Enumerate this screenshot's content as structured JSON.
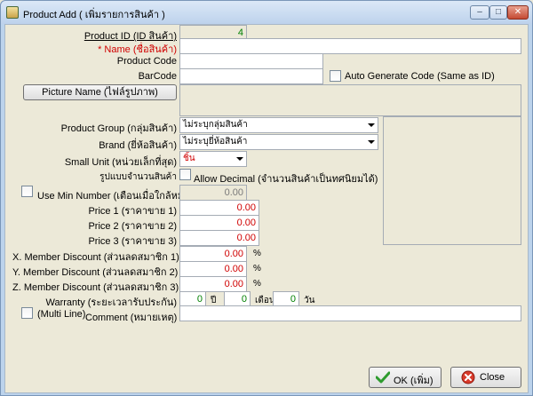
{
  "window": {
    "title": "Product Add ( เพิ่มรายการสินค้า )"
  },
  "titlebar": {
    "min": "–",
    "max": "□",
    "close": "✕"
  },
  "form": {
    "product_id": {
      "label": "Product ID (ID สินค้า)",
      "value": "4"
    },
    "name": {
      "label": "* Name (ชื่อสินค้า)",
      "value": ""
    },
    "product_code": {
      "label": "Product Code",
      "value": ""
    },
    "barcode": {
      "label": "BarCode",
      "value": ""
    },
    "auto_generate": {
      "label": "Auto Generate Code (Same as ID)",
      "checked": false
    },
    "picture_button": "Picture Name (ไฟล์รูปภาพ)",
    "product_group": {
      "label": "Product Group (กลุ่มสินค้า)",
      "value": "ไม่ระบุกลุ่มสินค้า"
    },
    "brand": {
      "label": "Brand (ยี่ห้อสินค้า)",
      "value": "ไม่ระบุยี่ห้อสินค้า"
    },
    "small_unit": {
      "label": "Small Unit (หน่วยเล็กที่สุด)",
      "value": "ชิ้น"
    },
    "quantity_format": {
      "label": "รูปแบบจำนวนสินค้า"
    },
    "allow_decimal": {
      "label": "Allow Decimal (จำนวนสินค้าเป็นทศนิยมได้)",
      "checked": false
    },
    "use_min_number": {
      "label": "Use Min Number (เตือนเมื่อใกล้หมด)",
      "value": "0.00",
      "checked": false
    },
    "price1": {
      "label": "Price 1 (ราคาขาย 1)",
      "value": "0.00"
    },
    "price2": {
      "label": "Price 2 (ราคาขาย 2)",
      "value": "0.00"
    },
    "price3": {
      "label": "Price 3 (ราคาขาย 3)",
      "value": "0.00"
    },
    "member_x": {
      "label": "X. Member Discount (ส่วนลดสมาชิก 1)",
      "value": "0.00",
      "unit": "%"
    },
    "member_y": {
      "label": "Y. Member Discount (ส่วนลดสมาชิก 2)",
      "value": "0.00",
      "unit": "%"
    },
    "member_z": {
      "label": "Z. Member Discount (ส่วนลดสมาชิก 3)",
      "value": "0.00",
      "unit": "%"
    },
    "warranty": {
      "label": "Warranty (ระยะเวลารับประกัน)",
      "years": "0",
      "years_unit": "ปี",
      "months": "0",
      "months_unit": "เดือน",
      "days": "0",
      "days_unit": "วัน"
    },
    "multi_line": {
      "label": "(Multi Line)",
      "checked": false
    },
    "comment": {
      "label": "Comment (หมายเหตุ)",
      "value": ""
    }
  },
  "buttons": {
    "ok": "OK (เพิ่ม)",
    "close": "Close"
  },
  "colors": {
    "accent_red": "#d00000",
    "id_green": "#008000"
  }
}
